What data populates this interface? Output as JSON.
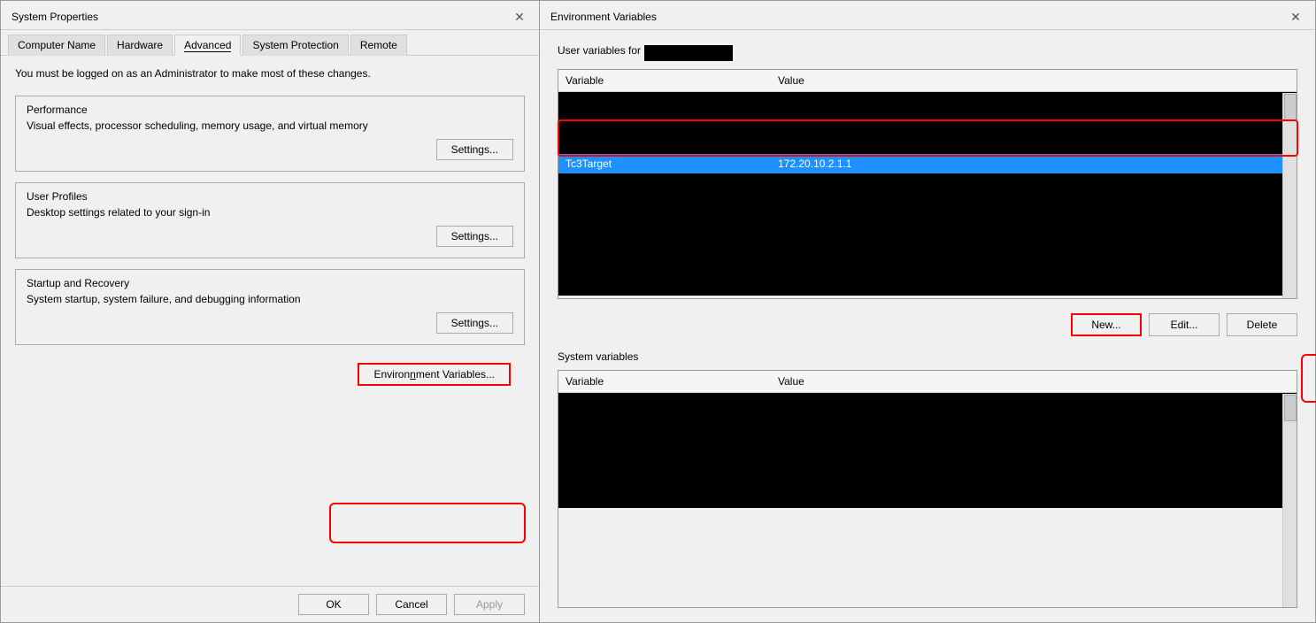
{
  "systemProperties": {
    "title": "System Properties",
    "tabs": [
      {
        "label": "Computer Name",
        "active": false
      },
      {
        "label": "Hardware",
        "active": false
      },
      {
        "label": "Advanced",
        "active": true
      },
      {
        "label": "System Protection",
        "active": false
      },
      {
        "label": "Remote",
        "active": false
      }
    ],
    "adminNote": "You must be logged on as an Administrator to make most of these changes.",
    "sections": [
      {
        "id": "performance",
        "title": "Performance",
        "description": "Visual effects, processor scheduling, memory usage, and virtual memory",
        "buttonLabel": "Settings..."
      },
      {
        "id": "userProfiles",
        "title": "User Profiles",
        "description": "Desktop settings related to your sign-in",
        "buttonLabel": "Settings..."
      },
      {
        "id": "startupRecovery",
        "title": "Startup and Recovery",
        "description": "System startup, system failure, and debugging information",
        "buttonLabel": "Settings..."
      }
    ],
    "envVarsButtonLabel": "Environ̲ment Variables...",
    "footer": {
      "ok": "OK",
      "cancel": "Cancel",
      "apply": "Apply"
    }
  },
  "envVariables": {
    "title": "Environment Variables",
    "userVarsLabel": "User variables for",
    "userName": "",
    "tableHeaders": [
      "Variable",
      "Value"
    ],
    "userRows": [
      {
        "variable": "",
        "value": "",
        "selected": false,
        "hidden": true
      },
      {
        "variable": "Tc3Target",
        "value": "172.20.10.2.1.1",
        "selected": true,
        "hidden": false
      },
      {
        "variable": "",
        "value": "",
        "selected": false,
        "hidden": true
      }
    ],
    "actionButtons": {
      "new": "New...",
      "edit": "Edit...",
      "delete": "Delete"
    },
    "sysVarsLabel": "System variables",
    "sysTableHeaders": [
      "Variable",
      "Value"
    ],
    "sysRows": []
  }
}
